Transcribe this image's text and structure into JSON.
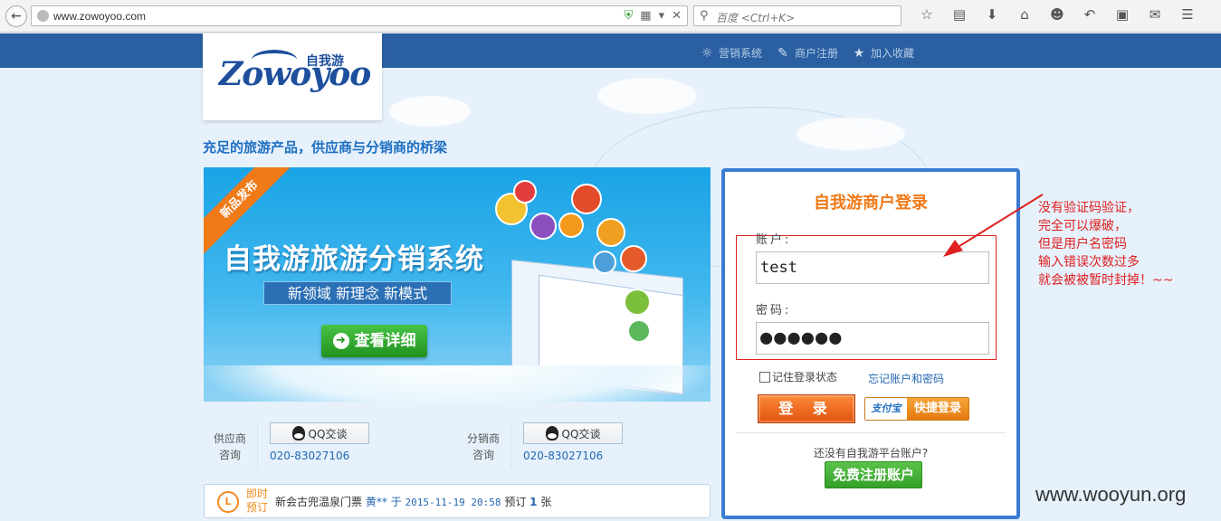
{
  "browser": {
    "url": "www.zowoyoo.com",
    "search_placeholder": "百度 <Ctrl+K>",
    "toolbar_icons": [
      "star-icon",
      "reader-icon",
      "download-icon",
      "home-icon",
      "chat-icon",
      "undo-icon",
      "dropdown-icon",
      "crop-icon",
      "dropdown-icon",
      "speech-icon",
      "menu-icon"
    ]
  },
  "header": {
    "logo_text": "Zowoyoo",
    "logo_cn": "自我游",
    "links": [
      {
        "label": "营销系统",
        "icon": "chat-bubbles-icon"
      },
      {
        "label": "商户注册",
        "icon": "edit-icon"
      },
      {
        "label": "加入收藏",
        "icon": "star-icon"
      }
    ],
    "tagline": "充足的旅游产品，供应商与分销商的桥梁"
  },
  "banner": {
    "ribbon": "新品发布",
    "title": "自我游旅游分销系统",
    "subtitle": "新领域 新理念 新模式",
    "button": "查看详细"
  },
  "contacts": [
    {
      "label_line1": "供应商",
      "label_line2": "咨询",
      "qq": "QQ交谈",
      "phone": "020-83027106"
    },
    {
      "label_line1": "分销商",
      "label_line2": "咨询",
      "qq": "QQ交谈",
      "phone": "020-83027106"
    }
  ],
  "live": {
    "tag_line1": "即时",
    "tag_line2": "预订",
    "product": "新会古兜温泉门票",
    "user": "黄**",
    "at": "于",
    "time": "2015-11-19 20:58",
    "action": "预订",
    "count": "1",
    "unit": "张"
  },
  "login": {
    "title": "自我游商户登录",
    "account_label": "账户:",
    "account_value": "test",
    "password_label": "密码:",
    "password_value": "●●●●●●",
    "remember": "记住登录状态",
    "forgot": "忘记账户和密码",
    "login_button": "登 录",
    "alipay_logo": "支付宝",
    "alipay_text": "快捷登录",
    "no_account": "还没有自我游平台账户?",
    "register_button": "免费注册账户"
  },
  "annotation": {
    "lines": [
      "没有验证码验证，",
      "完全可以爆破，",
      "但是用户名密码",
      "输入错误次数过多",
      "就会被被暂时封掉！~~"
    ]
  },
  "watermark": "www.wooyun.org",
  "colors": {
    "header_blue": "#2a5fa1",
    "accent_orange": "#f07a18",
    "panel_border": "#3b7bd1",
    "annotation_red": "#e02020"
  }
}
